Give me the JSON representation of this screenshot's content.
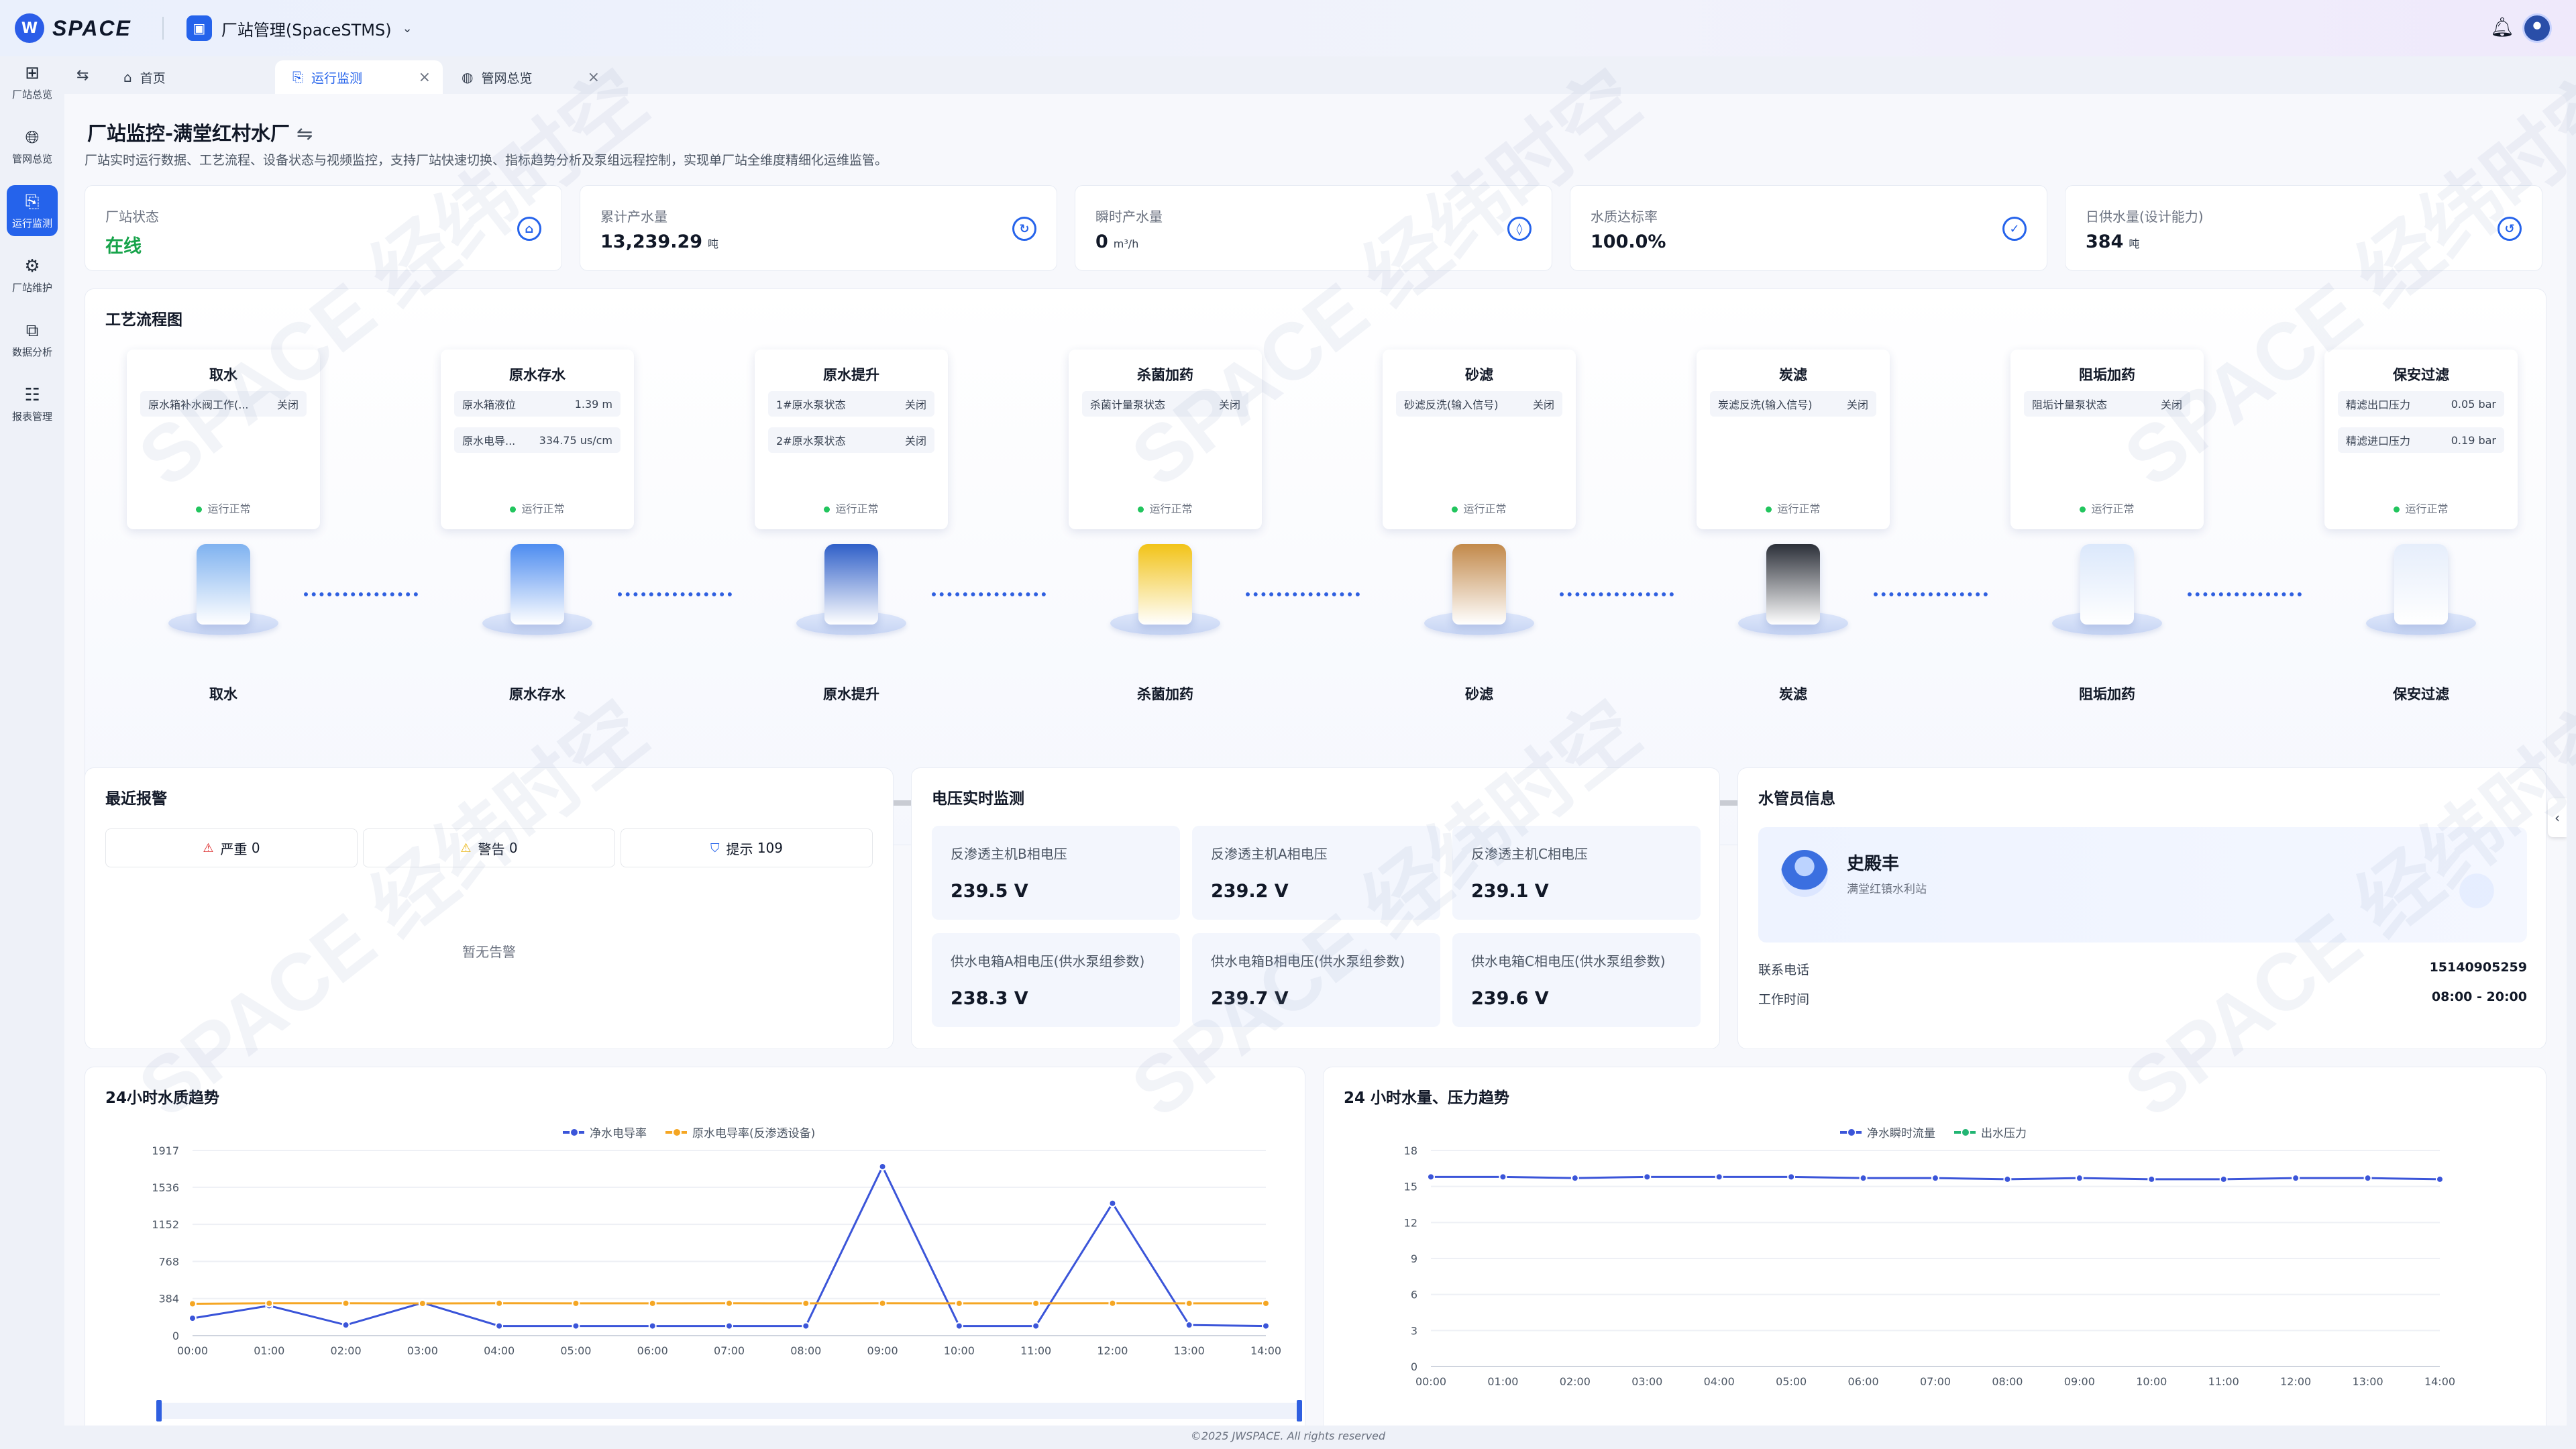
{
  "app": {
    "logo_text": "SPACE",
    "title": "厂站管理(SpaceSTMS)"
  },
  "sidebar": {
    "items": [
      {
        "label": "厂站总览",
        "icon": "grid-icon"
      },
      {
        "label": "管网总览",
        "icon": "globe-icon"
      },
      {
        "label": "运行监测",
        "icon": "monitor-icon",
        "active": true
      },
      {
        "label": "厂站维护",
        "icon": "gear-icon"
      },
      {
        "label": "数据分析",
        "icon": "chart-icon"
      },
      {
        "label": "报表管理",
        "icon": "report-icon"
      }
    ]
  },
  "tabs": [
    {
      "label": "首页",
      "icon": "home-icon"
    },
    {
      "label": "运行监测",
      "icon": "monitor-icon",
      "active": true
    },
    {
      "label": "管网总览",
      "icon": "globe-icon"
    }
  ],
  "page": {
    "title": "厂站监控-满堂红村水厂",
    "subtitle": "厂站实时运行数据、工艺流程、设备状态与视频监控，支持厂站快速切换、指标趋势分析及泵组远程控制，实现单厂站全维度精细化运维监管。"
  },
  "kpis": [
    {
      "label": "厂站状态",
      "value": "在线",
      "unit": "",
      "icon": "home-icon",
      "accent": "#16a34a"
    },
    {
      "label": "累计产水量",
      "value": "13,239.29",
      "unit": "吨",
      "icon": "water-cycle-icon"
    },
    {
      "label": "瞬时产水量",
      "value": "0",
      "unit": "m³/h",
      "icon": "drop-icon"
    },
    {
      "label": "水质达标率",
      "value": "100.0%",
      "unit": "",
      "icon": "check-circle-icon"
    },
    {
      "label": "日供水量(设计能力)",
      "value": "384",
      "unit": "吨",
      "icon": "supply-icon"
    }
  ],
  "process": {
    "title": "工艺流程图",
    "status_text": "运行正常",
    "stages": [
      {
        "name": "取水",
        "rows": [
          {
            "label": "原水箱补水阀工作(...",
            "value": "关闭"
          }
        ],
        "color": "#7fb2f0"
      },
      {
        "name": "原水存水",
        "rows": [
          {
            "label": "原水箱液位",
            "value": "1.39 m"
          },
          {
            "label": "原水电导...",
            "value": "334.75 us/cm"
          }
        ],
        "color": "#4d8cf0"
      },
      {
        "name": "原水提升",
        "rows": [
          {
            "label": "1#原水泵状态",
            "value": "关闭"
          },
          {
            "label": "2#原水泵状态",
            "value": "关闭"
          }
        ],
        "color": "#2f5fc8"
      },
      {
        "name": "杀菌加药",
        "rows": [
          {
            "label": "杀菌计量泵状态",
            "value": "关闭"
          }
        ],
        "color": "#f2c318"
      },
      {
        "name": "砂滤",
        "rows": [
          {
            "label": "砂滤反洗(输入信号)",
            "value": "关闭"
          }
        ],
        "color": "#c2894a"
      },
      {
        "name": "炭滤",
        "rows": [
          {
            "label": "炭滤反洗(输入信号)",
            "value": "关闭"
          }
        ],
        "color": "#2b2f38"
      },
      {
        "name": "阻垢加药",
        "rows": [
          {
            "label": "阻垢计量泵状态",
            "value": "关闭"
          }
        ],
        "color": "#dbe8fb"
      },
      {
        "name": "保安过滤",
        "rows": [
          {
            "label": "精滤出口压力",
            "value": "0.05 bar"
          },
          {
            "label": "精滤进口压力",
            "value": "0.19 bar"
          }
        ],
        "color": "#e6eefb"
      }
    ]
  },
  "alarms": {
    "title": "最近报警",
    "chips": [
      {
        "label": "严重",
        "count": "0",
        "icon": "alarm-red-icon",
        "color": "#dc2626"
      },
      {
        "label": "警告",
        "count": "0",
        "icon": "alarm-yellow-icon",
        "color": "#eab308"
      },
      {
        "label": "提示",
        "count": "109",
        "icon": "shield-info-icon",
        "color": "#2563eb"
      }
    ],
    "empty_text": "暂无告警"
  },
  "voltage": {
    "title": "电压实时监测",
    "items": [
      {
        "label": "反渗透主机B相电压",
        "value": "239.5 V"
      },
      {
        "label": "反渗透主机A相电压",
        "value": "239.2 V"
      },
      {
        "label": "反渗透主机C相电压",
        "value": "239.1 V"
      },
      {
        "label": "供水电箱A相电压(供水泵组参数)",
        "value": "238.3 V"
      },
      {
        "label": "供水电箱B相电压(供水泵组参数)",
        "value": "239.7 V"
      },
      {
        "label": "供水电箱C相电压(供水泵组参数)",
        "value": "239.6 V"
      }
    ]
  },
  "staff": {
    "title": "水管员信息",
    "name": "史殿丰",
    "org": "满堂红镇水利站",
    "phone_label": "联系电话",
    "phone": "15140905259",
    "hours_label": "工作时间",
    "hours": "08:00 - 20:00"
  },
  "charts": {
    "quality_title": "24小时水质趋势",
    "flow_title": "24 小时水量、压力趋势"
  },
  "chart_data": [
    {
      "type": "line",
      "title": "24小时水质趋势",
      "x": [
        "00:00",
        "01:00",
        "02:00",
        "03:00",
        "04:00",
        "05:00",
        "06:00",
        "07:00",
        "08:00",
        "09:00",
        "10:00",
        "11:00",
        "12:00",
        "13:00",
        "14:00"
      ],
      "ylim": [
        0,
        1917
      ],
      "yticks": [
        0,
        384,
        768,
        1152,
        1536,
        1917
      ],
      "series": [
        {
          "name": "净水电导率",
          "color": "#3b55d9",
          "values": [
            180,
            310,
            110,
            340,
            100,
            100,
            100,
            100,
            100,
            1750,
            100,
            100,
            1370,
            110,
            100
          ]
        },
        {
          "name": "原水电导率(反渗透设备)",
          "color": "#f5a623",
          "values": [
            330,
            335,
            335,
            333,
            335,
            334,
            334,
            335,
            334,
            335,
            334,
            334,
            335,
            334,
            334
          ]
        }
      ]
    },
    {
      "type": "area",
      "title": "24 小时水量、压力趋势",
      "x": [
        "00:00",
        "01:00",
        "02:00",
        "03:00",
        "04:00",
        "05:00",
        "06:00",
        "07:00",
        "08:00",
        "09:00",
        "10:00",
        "11:00",
        "12:00",
        "13:00",
        "14:00"
      ],
      "ylim": [
        0,
        18
      ],
      "yticks": [
        0,
        3,
        6,
        9,
        12,
        15,
        18
      ],
      "series": [
        {
          "name": "净水瞬时流量",
          "color": "#3b55d9",
          "values": [
            15.8,
            15.8,
            15.7,
            15.8,
            15.8,
            15.8,
            15.7,
            15.7,
            15.6,
            15.7,
            15.6,
            15.6,
            15.7,
            15.7,
            15.6
          ]
        },
        {
          "name": "出水压力",
          "color": "#22b573",
          "values": []
        }
      ]
    }
  ],
  "footer": "©2025 JWSPACE. All rights reserved",
  "watermark": "SPACE 经纬时空"
}
